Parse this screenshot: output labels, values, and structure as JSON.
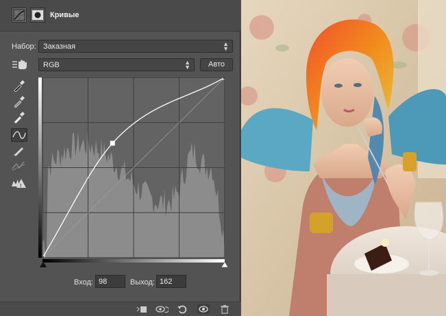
{
  "panel": {
    "title": "Кривые",
    "preset_label": "Набор:",
    "preset_value": "Заказная",
    "channel_value": "RGB",
    "auto_button": "Авто",
    "input_label": "Вход:",
    "input_value": "98",
    "output_label": "Выход:",
    "output_value": "162"
  },
  "tools": [
    "eyedropper-black-icon",
    "eyedropper-gray-icon",
    "eyedropper-white-icon",
    "curve-point-icon",
    "pencil-icon",
    "smooth-icon",
    "clipping-warning-icon"
  ],
  "curve": {
    "input_range": [
      0,
      255
    ],
    "output_range": [
      0,
      255
    ],
    "points": [
      [
        0,
        0
      ],
      [
        98,
        162
      ],
      [
        255,
        255
      ]
    ]
  },
  "colors": {
    "panel_bg": "#535353",
    "histogram": "#8c8c8c",
    "graph_bg": "#636363"
  }
}
